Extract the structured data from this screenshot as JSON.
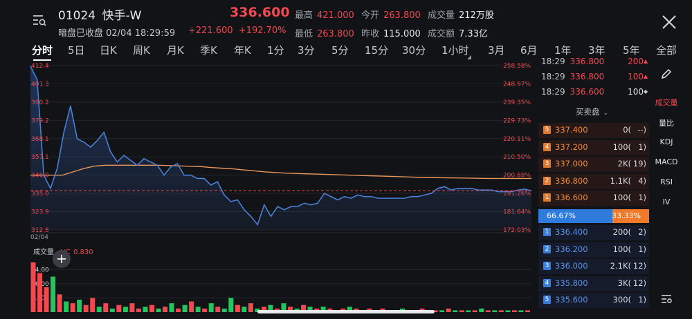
{
  "header": {
    "code": "01024",
    "name": "快手-W",
    "price": "336.600",
    "status": "暗盘已收盘 02/04 18:29:59",
    "change_abs": "+221.600",
    "change_pct": "+192.70%",
    "high_label": "最高",
    "high": "421.000",
    "low_label": "最低",
    "low": "263.800",
    "open_label": "今开",
    "open": "263.800",
    "prev_close_label": "昨收",
    "prev_close": "115.000",
    "volume_label": "成交量",
    "volume": "212万股",
    "turnover_label": "成交额",
    "turnover": "7.33亿"
  },
  "tabs": [
    "分时",
    "5日",
    "日K",
    "周K",
    "月K",
    "季K",
    "年K",
    "1分",
    "3分",
    "5分",
    "15分",
    "30分",
    "1小时",
    "3月",
    "6月",
    "1年",
    "3年",
    "5年",
    "全部"
  ],
  "colors": {
    "up": "#f2484f",
    "down": "#22c55e",
    "line": "#4a7fd6",
    "avg": "#e8965a",
    "bg": "#121316"
  },
  "chart_data": [
    {
      "type": "line",
      "x_label_start": "02/04",
      "y_ticks_left": [
        "412.4",
        "401.3",
        "390.2",
        "379.2",
        "368.1",
        "357.1",
        "346.0",
        "335.0",
        "323.9",
        "312.8"
      ],
      "y_ticks_right": [
        "258.58%",
        "248.97%",
        "239.35%",
        "229.73%",
        "220.11%",
        "210.50%",
        "200.88%",
        "191.26%",
        "181.64%",
        "172.03%"
      ],
      "ylim": [
        312.8,
        412.4
      ],
      "reference_line": 336.6,
      "series": [
        {
          "role": "price",
          "values": [
            412.0,
            404.0,
            346.0,
            338.0,
            350.0,
            372.0,
            388.0,
            368.0,
            366.0,
            363.0,
            367.0,
            372.0,
            360.0,
            354.0,
            358.0,
            355.0,
            352.0,
            356.0,
            354.0,
            352.0,
            346.0,
            351.0,
            353.0,
            346.0,
            346.0,
            344.0,
            344.0,
            340.0,
            342.0,
            334.0,
            330.0,
            331.0,
            325.0,
            321.0,
            316.0,
            328.0,
            321.0,
            327.0,
            325.0,
            327.0,
            327.0,
            329.0,
            328.0,
            329.0,
            335.0,
            333.0,
            331.0,
            333.0,
            332.0,
            334.0,
            333.0,
            333.0,
            332.0,
            332.0,
            332.0,
            332.0,
            332.0,
            333.0,
            333.0,
            334.0,
            335.0,
            338.0,
            339.0,
            337.0,
            338.0,
            338.0,
            338.0,
            337.0,
            337.0,
            337.0,
            336.0,
            336.0,
            336.0,
            337.0,
            337.5,
            336.6
          ]
        },
        {
          "role": "average",
          "values": [
            346.0,
            346.0,
            346.0,
            346.0,
            348.0,
            350.0,
            351.5,
            352.0,
            352.0,
            352.0,
            352.0,
            352.0,
            352.0,
            351.8,
            351.6,
            351.4,
            351.2,
            350.6,
            350.2,
            349.8,
            349.2,
            348.6,
            348.0,
            347.6,
            347.2,
            347.0,
            346.8,
            346.6,
            346.4,
            346.2,
            346.0,
            345.8,
            345.6,
            345.4,
            345.2,
            345.0,
            344.8,
            344.6,
            344.5,
            344.4,
            344.3,
            344.2,
            344.1,
            344.0,
            344.0,
            344.0,
            344.0,
            344.0
          ]
        }
      ]
    },
    {
      "type": "bar",
      "title": "成交量",
      "indicator": "VC",
      "indicator_value": "0.830",
      "y_ticks": [
        "24.00",
        "16.00",
        "8.000"
      ],
      "ylim": [
        0,
        28
      ],
      "values": [
        28,
        22,
        14,
        20,
        10,
        6,
        5,
        7,
        4,
        8,
        3,
        5,
        2,
        4,
        3,
        5,
        2,
        3,
        4,
        2,
        3,
        5,
        2,
        4,
        6,
        3,
        2,
        5,
        3,
        2,
        8,
        4,
        3,
        5,
        2,
        3,
        4,
        2,
        5,
        3,
        2,
        4,
        3,
        2,
        3,
        2,
        1,
        2,
        3,
        2,
        1,
        2,
        1,
        2,
        1,
        1,
        2,
        1,
        1,
        2,
        1,
        1,
        1,
        2,
        1,
        1,
        1,
        1,
        2,
        1,
        1,
        1,
        1,
        1,
        1,
        1
      ],
      "colors": [
        "up",
        "up",
        "up",
        "down",
        "up",
        "down",
        "up",
        "down",
        "up",
        "up",
        "down",
        "up",
        "down",
        "up",
        "down",
        "up",
        "up",
        "down",
        "up",
        "down",
        "up",
        "down",
        "up",
        "down",
        "up",
        "down",
        "up",
        "down",
        "up",
        "down",
        "down",
        "up",
        "down",
        "up",
        "down",
        "up",
        "down",
        "up",
        "down",
        "up",
        "down",
        "up",
        "down",
        "up",
        "down",
        "up",
        "down",
        "up",
        "down",
        "up",
        "down",
        "up",
        "down",
        "up",
        "down",
        "up",
        "down",
        "up",
        "down",
        "up",
        "down",
        "up",
        "down",
        "up",
        "down",
        "up",
        "down",
        "up",
        "down",
        "up",
        "down",
        "up",
        "down",
        "up",
        "down",
        "up"
      ]
    }
  ],
  "trades": [
    {
      "time": "18:29",
      "price": "336.800",
      "vol": "200",
      "dir": "up"
    },
    {
      "time": "18:29",
      "price": "336.800",
      "vol": "100",
      "dir": "up"
    },
    {
      "time": "18:29",
      "price": "336.600",
      "vol": "100",
      "dir": "neutral"
    }
  ],
  "orderbook": {
    "title": "买卖盘",
    "sell": [
      {
        "level": "5",
        "price": "337.400",
        "vol": "0(",
        "cnt": "--)"
      },
      {
        "level": "4",
        "price": "337.200",
        "vol": "100(",
        "cnt": "1)"
      },
      {
        "level": "3",
        "price": "337.000",
        "vol": "2K(",
        "cnt": "19)"
      },
      {
        "level": "2",
        "price": "336.800",
        "vol": "1.1K(",
        "cnt": "4)"
      },
      {
        "level": "1",
        "price": "336.600",
        "vol": "100(",
        "cnt": "1)"
      }
    ],
    "buy_ratio": "66.67%",
    "sell_ratio": "33.33%",
    "buy_ratio_value": 66.67,
    "buy": [
      {
        "level": "1",
        "price": "336.400",
        "vol": "200(",
        "cnt": "2)"
      },
      {
        "level": "2",
        "price": "336.200",
        "vol": "100(",
        "cnt": "1)"
      },
      {
        "level": "3",
        "price": "336.000",
        "vol": "2.1K(",
        "cnt": "12)"
      },
      {
        "level": "4",
        "price": "335.800",
        "vol": "3K(",
        "cnt": "12)"
      },
      {
        "level": "5",
        "price": "335.600",
        "vol": "300(",
        "cnt": "1)"
      }
    ]
  },
  "side_tools": [
    "成交量",
    "量比",
    "KDJ",
    "MACD",
    "RSI",
    "IV"
  ]
}
